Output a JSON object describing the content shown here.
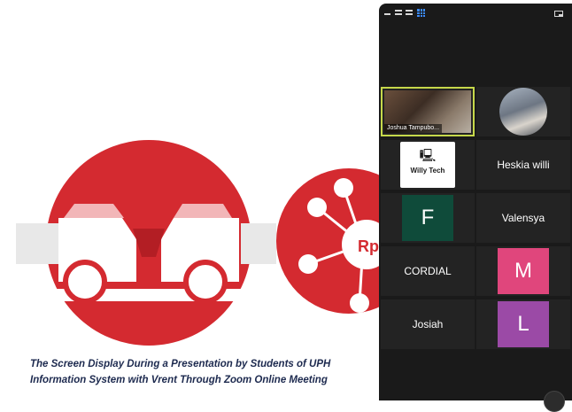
{
  "slide": {
    "overlay_text": "Rp",
    "colors": {
      "brand_red": "#d42a30",
      "bg": "#ffffff"
    }
  },
  "caption": {
    "line1": "The Screen Display During a Presentation by Students of UPH",
    "line2": "Information System with Vrent Through Zoom Online Meeting"
  },
  "zoom": {
    "toolbar_icons": [
      "minimize-icon",
      "speaker-view-icon",
      "strip-view-icon",
      "gallery-view-icon",
      "exit-fullscreen-icon"
    ],
    "participants": [
      {
        "name": "Joshua Tampubo...",
        "type": "video",
        "active": true
      },
      {
        "name": "",
        "type": "photo"
      },
      {
        "name": "",
        "type": "logo",
        "logo_text": "Willy Tech"
      },
      {
        "name": "Heskia willi",
        "type": "name"
      },
      {
        "name": "",
        "type": "letter",
        "letter": "F",
        "color": "#0f4b3a"
      },
      {
        "name": "Valensya",
        "type": "name"
      },
      {
        "name": "CORDIAL",
        "type": "name"
      },
      {
        "name": "",
        "type": "letter",
        "letter": "M",
        "color": "#e0467c"
      },
      {
        "name": "Josiah",
        "type": "name"
      },
      {
        "name": "",
        "type": "letter",
        "letter": "L",
        "color": "#9b4aa6"
      }
    ]
  }
}
